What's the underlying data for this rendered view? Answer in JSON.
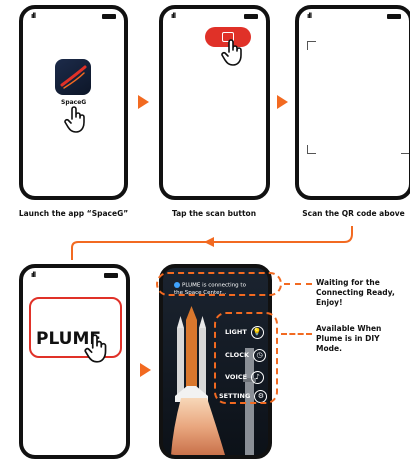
{
  "steps": {
    "launch_caption": "Launch the app “SpaceG”",
    "scan_button_caption": "Tap the scan button",
    "scan_qr_caption": "Scan the QR code above"
  },
  "app": {
    "icon_label": "SpaceG",
    "icon_name": "rocket-logo-icon"
  },
  "plume_card": {
    "label": "PLUME"
  },
  "connect_banner": {
    "text": "PLUME is connecting to the Space Center..."
  },
  "controls": {
    "light": "LIGHT",
    "clock": "CLOCK",
    "voice": "VOICE",
    "setting": "SETTING"
  },
  "notes": {
    "waiting": "Waiting for the Connecting Ready, Enjoy!",
    "available": "Available When Plume is in DIY Mode."
  },
  "colors": {
    "accent_orange": "#f26a21",
    "accent_red": "#e03128"
  }
}
